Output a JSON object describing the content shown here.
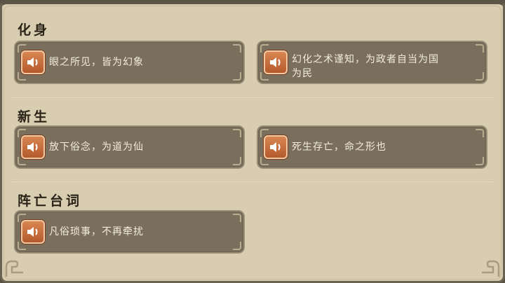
{
  "sections": [
    {
      "title": "化身",
      "lines": [
        "眼之所见，皆为幻象",
        "幻化之术谨知，为政者自当为国为民"
      ]
    },
    {
      "title": "新生",
      "lines": [
        "放下俗念，为道为仙",
        "死生存亡，命之形也"
      ]
    },
    {
      "title": "阵亡台词",
      "lines": [
        "凡俗琐事，不再牵扰"
      ]
    }
  ],
  "icons": {
    "play": "speaker-icon"
  },
  "colors": {
    "card": "#7a6f5c",
    "panel": "#d8cdb0",
    "button": "#c8703f"
  }
}
